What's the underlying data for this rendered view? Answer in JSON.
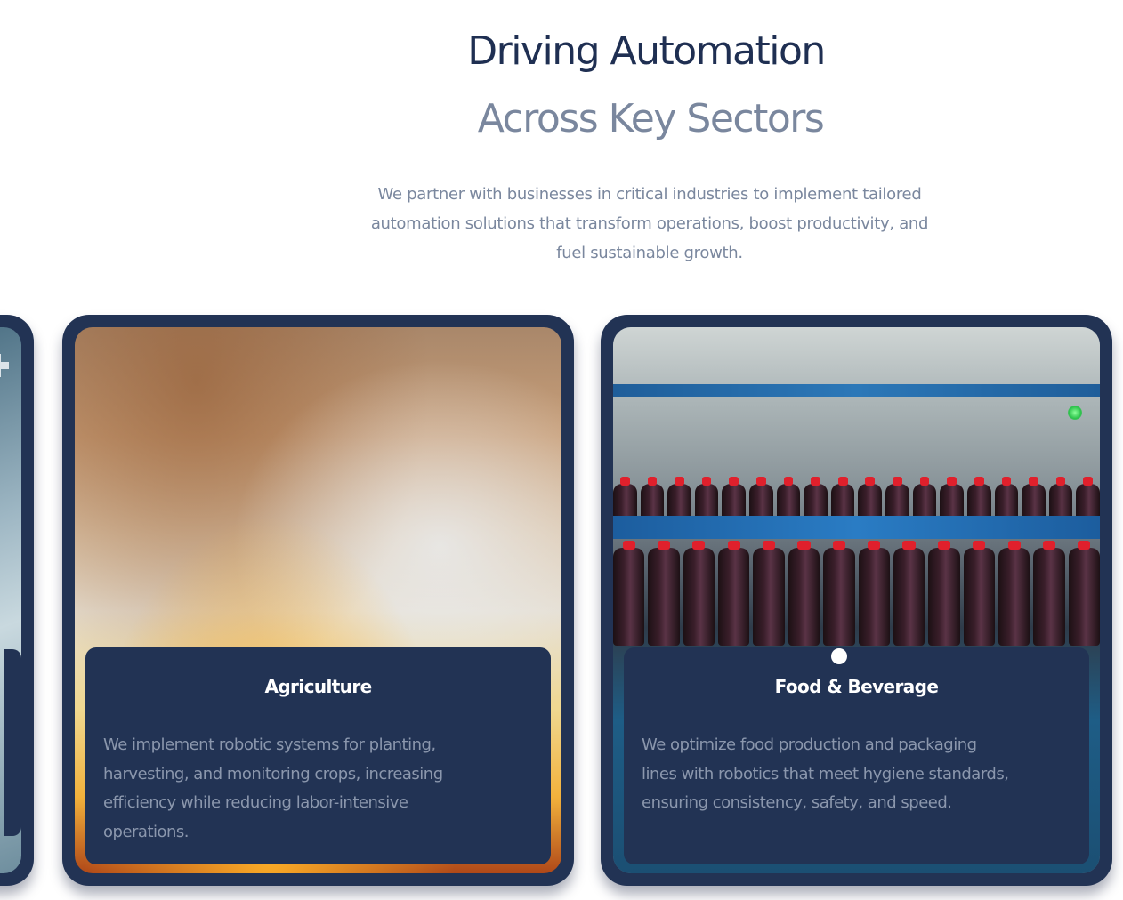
{
  "section": {
    "title_line1": "Driving Automation",
    "title_line2": "Across Key Sectors",
    "intro": "We partner with businesses in critical industries to implement tailored automation solutions that transform operations, boost productivity, and fuel sustainable growth."
  },
  "cards": [
    {
      "title": "Agriculture",
      "description": "We implement robotic systems for planting, harvesting, and monitoring crops, increasing efficiency while reducing labor-intensive operations."
    },
    {
      "title": "Food & Beverage",
      "description": "We optimize food production and packaging lines with robotics that meet hygiene standards, ensuring consistency, safety, and speed."
    }
  ],
  "colors": {
    "navy": "#223354",
    "heading": "#1f2f52",
    "muted": "#7a879e",
    "bottle_cap": "#e0202c"
  }
}
